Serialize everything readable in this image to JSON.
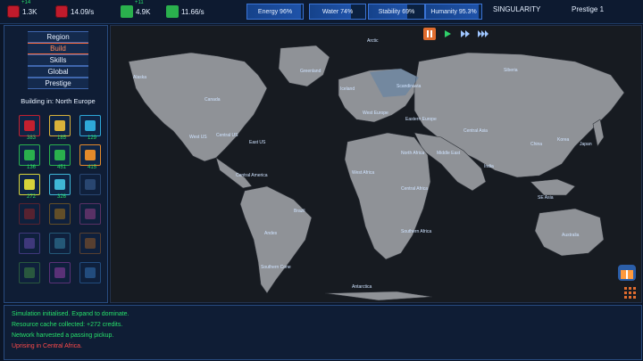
{
  "topbar": {
    "resources": [
      {
        "name": "compute",
        "value": "1.3K",
        "sub": "+14",
        "icon": "cpu-icon"
      },
      {
        "name": "compute-rate",
        "value": "14.09/s",
        "sub": "",
        "icon": "cpu-icon"
      },
      {
        "name": "credits",
        "value": "4.9K",
        "sub": "+11",
        "icon": "cash-icon"
      },
      {
        "name": "credits-rate",
        "value": "11.66/s",
        "sub": "",
        "icon": "cash-icon"
      }
    ],
    "meters": [
      {
        "label": "Energy 96%",
        "value": 0.96
      },
      {
        "label": "Water 74%",
        "value": 0.74
      },
      {
        "label": "Stability 69%",
        "value": 0.69
      },
      {
        "label": "Humanity 95.3%",
        "value": 0.953
      }
    ],
    "phase": "SINGULARITY",
    "prestige": "Prestige 1"
  },
  "nav": [
    "Region",
    "Build",
    "Skills",
    "Global",
    "Prestige"
  ],
  "nav_active": "Build",
  "building_in": "Building in: North Europe",
  "buildings": [
    {
      "icon": "processor-icon",
      "count": "383",
      "color": "#c3202f"
    },
    {
      "icon": "battery-icon",
      "count": "185",
      "color": "#d8b23a"
    },
    {
      "icon": "water-drop-icon",
      "count": "129",
      "color": "#2ea8d8"
    },
    {
      "icon": "server-icon",
      "count": "136",
      "color": "#2ab04d"
    },
    {
      "icon": "chip-icon",
      "count": "451",
      "color": "#2ab04d"
    },
    {
      "icon": "reactor-icon",
      "count": "415",
      "color": "#e48a2a"
    },
    {
      "icon": "solar-icon",
      "count": "272",
      "color": "#d6d23a"
    },
    {
      "icon": "vortex-icon",
      "count": "326",
      "color": "#3fb6d6"
    },
    {
      "icon": "droplet-shield-icon",
      "count": "",
      "color": "#4a78b8"
    },
    {
      "icon": "tower-icon",
      "count": "",
      "color": "#b02a2a"
    },
    {
      "icon": "hand-icon",
      "count": "",
      "color": "#c78b1a"
    },
    {
      "icon": "heart-hands-icon",
      "count": "",
      "color": "#b44aa0"
    },
    {
      "icon": "device-icon",
      "count": "",
      "color": "#7a5ad0"
    },
    {
      "icon": "wave-icon",
      "count": "",
      "color": "#3fa0c8"
    },
    {
      "icon": "factory-icon",
      "count": "",
      "color": "#b06a2a"
    },
    {
      "icon": "brain-icon",
      "count": "",
      "color": "#4aa04a"
    },
    {
      "icon": "skull-icon",
      "count": "",
      "color": "#b44ac8"
    },
    {
      "icon": "atom-icon",
      "count": "",
      "color": "#3a86d8"
    }
  ],
  "regions": [
    {
      "label": "Alaska"
    },
    {
      "label": "Canada"
    },
    {
      "label": "Greenland"
    },
    {
      "label": "Arctic"
    },
    {
      "label": "Iceland"
    },
    {
      "label": "Scandinavia"
    },
    {
      "label": "Siberia"
    },
    {
      "label": "West Europe"
    },
    {
      "label": "Eastern Europe"
    },
    {
      "label": "West US"
    },
    {
      "label": "Central US"
    },
    {
      "label": "East US"
    },
    {
      "label": "Central America"
    },
    {
      "label": "North Africa"
    },
    {
      "label": "Middle East"
    },
    {
      "label": "Central Asia"
    },
    {
      "label": "India"
    },
    {
      "label": "China"
    },
    {
      "label": "Korea"
    },
    {
      "label": "Japan"
    },
    {
      "label": "SE Asia"
    },
    {
      "label": "West Africa"
    },
    {
      "label": "Central Africa"
    },
    {
      "label": "Brazil"
    },
    {
      "label": "Andes"
    },
    {
      "label": "Southern Africa"
    },
    {
      "label": "Southern Cone"
    },
    {
      "label": "Australia"
    },
    {
      "label": "Antarctica"
    }
  ],
  "log": [
    {
      "text": "Simulation initialised. Expand to dominate.",
      "color": "#27e06b"
    },
    {
      "text": "Resource cache collected: +272 credits.",
      "color": "#27e06b"
    },
    {
      "text": "Network harvested a passing pickup.",
      "color": "#27e06b"
    },
    {
      "text": "Uprising in Central Africa.",
      "color": "#ff4a4a"
    }
  ]
}
